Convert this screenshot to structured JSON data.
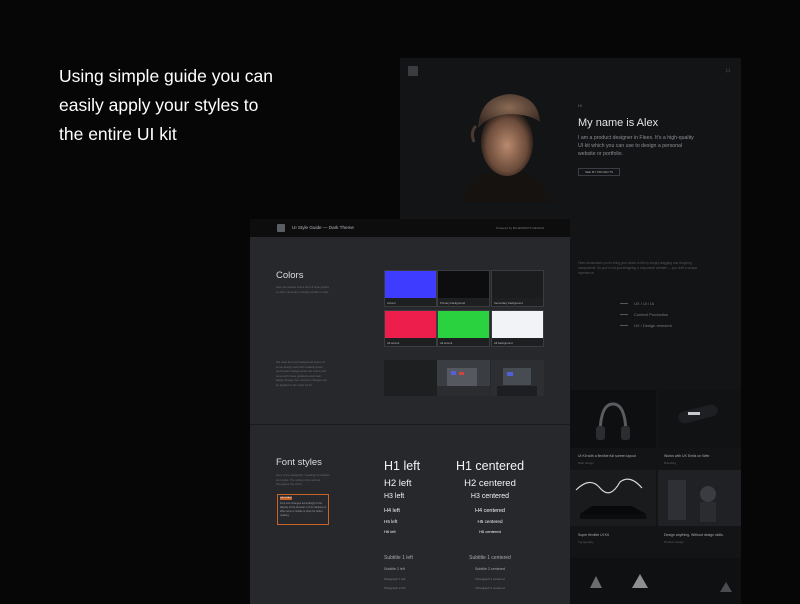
{
  "headline": {
    "line1": "Using simple guide you can",
    "line2": "easily apply your styles to",
    "line3": "the entire UI kit"
  },
  "portfolio": {
    "menu_icon": "grid-icon",
    "small_label": "Hi",
    "name": "My name is Alex",
    "bio": "I am a product designer in Fleex. It's a high-quality UI kit which you can use to design a personal website or portfolio.",
    "button_label": "SEE MY PROJECTS",
    "paragraph": "Fleex showcases you to bring your vision to life by simply dragging and dropping components. So you're not just designing a responsive website — you craft a unique experience.",
    "services": [
      "UX / UI / IA",
      "Content Production",
      "UX / Design research"
    ],
    "tiles": [
      {
        "title": "UI Kit with a flexible full screen layout",
        "subtitle": "Web design"
      },
      {
        "title": "Works with UX Emils on Web",
        "subtitle": "Branding"
      },
      {
        "title": "Super flexible UI Kit",
        "subtitle": "Typography"
      },
      {
        "title": "Design anything. Without design skills.",
        "subtitle": "Product design"
      }
    ]
  },
  "guide": {
    "title": "UI Style Guide — Dark Theme",
    "powered": "Powered by BLUEPRINTS DESIGN",
    "colors": {
      "title": "Colors",
      "description": "Here are palette colors and UI style guides to other elements in design similar to style.",
      "swatches": [
        {
          "label": "Accent",
          "color": "#3d3cff"
        },
        {
          "label": "Primary background",
          "color": "#0d0d0f"
        },
        {
          "label": "Secondary background",
          "color": "#1b1c1e"
        },
        {
          "label": "Alt accent",
          "color": "#ee1e4c"
        },
        {
          "label": "Alt accent",
          "color": "#2ad240"
        },
        {
          "label": "Alt background",
          "color": "#f2f3f6"
        }
      ]
    },
    "images_desc": "We used the best background styles on some design parts with realistic photo and texture backgrounds, the colors and tones with these gradients work well. Easily change them and the changes will be applied to the entire UI kit.",
    "fonts": {
      "title": "Font styles",
      "description": "Here is the paragraph, headings & subtitles text styles. The sizing is the optimal throughout the UI Kit.",
      "note_tag": "IMPORTANT",
      "note_text": "Font size changes accordingly to the display of the browser. H1 for desktop is 28px and on mobile is 22px for better reading.",
      "left": {
        "h1": "H1 left",
        "h2": "H2 left",
        "h3": "H3 left",
        "h4": "H4 left",
        "h5": "H5 left",
        "h6": "H6 left",
        "subtitle": "Subtitle 1 left",
        "subtitle2": "Subtitle 2 left",
        "para1": "Paragraph 1 left",
        "para2": "Paragraph 2 left"
      },
      "center": {
        "h1": "H1 centered",
        "h2": "H2 centered",
        "h3": "H3 centered",
        "h4": "H4 centered",
        "h5": "H5 centered",
        "h6": "H6 centered",
        "subtitle": "Subtitle 1 centered",
        "subtitle2": "Subtitle 2 centered",
        "para1": "Paragraph 1 centered",
        "para2": "Paragraph 2 centered"
      }
    }
  }
}
